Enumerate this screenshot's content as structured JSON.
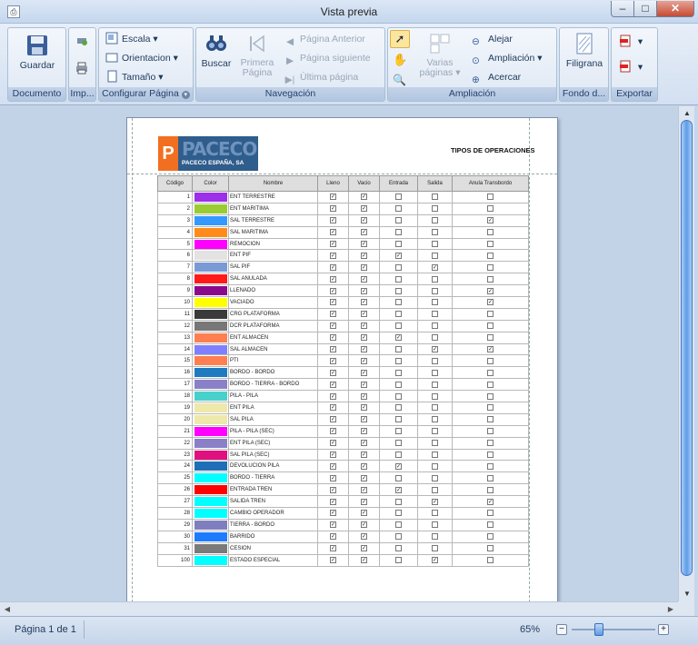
{
  "window": {
    "title": "Vista previa"
  },
  "ribbon": {
    "groups": {
      "documento": "Documento",
      "imprimir": "Imp...",
      "configurar": "Configurar Página",
      "navegacion": "Navegación",
      "ampliacion": "Ampliación",
      "fondo": "Fondo d...",
      "exportar": "Exportar"
    },
    "buttons": {
      "guardar": "Guardar",
      "escala": "Escala",
      "orientacion": "Orientacion",
      "tamano": "Tamaño",
      "buscar": "Buscar",
      "primera_pagina": "Primera Página",
      "pagina_anterior": "Página Anterior",
      "pagina_siguiente": "Página siguiente",
      "ultima_pagina": "Última página",
      "varias_paginas": "Varias páginas",
      "alejar": "Alejar",
      "ampliacion": "Ampliación",
      "acercar": "Acercar",
      "filigrana": "Filigrana"
    }
  },
  "document": {
    "logo_text": "PACECO",
    "logo_sub": "PACECO ESPAÑA, SA",
    "title": "TIPOS DE OPERACIONES",
    "dot": ".",
    "columns": [
      "Código",
      "Color",
      "Nombre",
      "Lleno",
      "Vacio",
      "Entrada",
      "Salida",
      "Anula Transbordo"
    ],
    "rows": [
      {
        "code": "1",
        "color": "#9b30e8",
        "name": "ENT TERRESTRE",
        "lleno": true,
        "vacio": true,
        "entrada": false,
        "salida": false,
        "anula": false
      },
      {
        "code": "2",
        "color": "#99cc33",
        "name": "ENT MARITIMA",
        "lleno": true,
        "vacio": true,
        "entrada": false,
        "salida": false,
        "anula": false
      },
      {
        "code": "3",
        "color": "#3399ff",
        "name": "SAL TERRESTRE",
        "lleno": true,
        "vacio": true,
        "entrada": false,
        "salida": false,
        "anula": true
      },
      {
        "code": "4",
        "color": "#ff8c1a",
        "name": "SAL MARITIMA",
        "lleno": true,
        "vacio": true,
        "entrada": false,
        "salida": false,
        "anula": false
      },
      {
        "code": "5",
        "color": "#ff00ff",
        "name": "REMOCION",
        "lleno": true,
        "vacio": true,
        "entrada": false,
        "salida": false,
        "anula": false
      },
      {
        "code": "6",
        "color": "#e3e3e3",
        "name": "ENT PIF",
        "lleno": true,
        "vacio": true,
        "entrada": true,
        "salida": false,
        "anula": false
      },
      {
        "code": "7",
        "color": "#7a9ad6",
        "name": "SAL PIF",
        "lleno": true,
        "vacio": true,
        "entrada": false,
        "salida": true,
        "anula": false
      },
      {
        "code": "8",
        "color": "#ff1a1a",
        "name": "SAL ANULADA",
        "lleno": true,
        "vacio": true,
        "entrada": false,
        "salida": false,
        "anula": false
      },
      {
        "code": "9",
        "color": "#8b0a8b",
        "name": "LLENADO",
        "lleno": true,
        "vacio": true,
        "entrada": false,
        "salida": false,
        "anula": true
      },
      {
        "code": "10",
        "color": "#ffff00",
        "name": "VACIADO",
        "lleno": true,
        "vacio": true,
        "entrada": false,
        "salida": false,
        "anula": true
      },
      {
        "code": "11",
        "color": "#3a3a3a",
        "name": "CRG PLATAFORMA",
        "lleno": true,
        "vacio": true,
        "entrada": false,
        "salida": false,
        "anula": false
      },
      {
        "code": "12",
        "color": "#777777",
        "name": "DCR PLATAFORMA",
        "lleno": true,
        "vacio": true,
        "entrada": false,
        "salida": false,
        "anula": false
      },
      {
        "code": "13",
        "color": "#ff7f50",
        "name": "ENT ALMACEN",
        "lleno": true,
        "vacio": true,
        "entrada": true,
        "salida": false,
        "anula": false
      },
      {
        "code": "14",
        "color": "#8080ff",
        "name": "SAL ALMACEN",
        "lleno": true,
        "vacio": true,
        "entrada": false,
        "salida": true,
        "anula": true
      },
      {
        "code": "15",
        "color": "#ff7f50",
        "name": "PTI",
        "lleno": true,
        "vacio": true,
        "entrada": false,
        "salida": false,
        "anula": false
      },
      {
        "code": "16",
        "color": "#1e7bbf",
        "name": "BORDO - BORDO",
        "lleno": true,
        "vacio": true,
        "entrada": false,
        "salida": false,
        "anula": false
      },
      {
        "code": "17",
        "color": "#8a80c8",
        "name": "BORDO - TIERRA - BORDO",
        "lleno": true,
        "vacio": true,
        "entrada": false,
        "salida": false,
        "anula": false
      },
      {
        "code": "18",
        "color": "#48d1cc",
        "name": "PILA - PILA",
        "lleno": true,
        "vacio": true,
        "entrada": false,
        "salida": false,
        "anula": false
      },
      {
        "code": "19",
        "color": "#eee8aa",
        "name": "ENT PILA",
        "lleno": true,
        "vacio": true,
        "entrada": false,
        "salida": false,
        "anula": false
      },
      {
        "code": "20",
        "color": "#eee8aa",
        "name": "SAL PILA",
        "lleno": true,
        "vacio": true,
        "entrada": false,
        "salida": false,
        "anula": false
      },
      {
        "code": "21",
        "color": "#ff00ff",
        "name": "PILA - PILA (SEC)",
        "lleno": true,
        "vacio": true,
        "entrada": false,
        "salida": false,
        "anula": false
      },
      {
        "code": "22",
        "color": "#8a80c8",
        "name": "ENT PILA (SEC)",
        "lleno": true,
        "vacio": true,
        "entrada": false,
        "salida": false,
        "anula": false
      },
      {
        "code": "23",
        "color": "#e0117e",
        "name": "SAL PILA (SEC)",
        "lleno": true,
        "vacio": true,
        "entrada": false,
        "salida": false,
        "anula": false
      },
      {
        "code": "24",
        "color": "#1e6fb8",
        "name": "DEVOLUCION PILA",
        "lleno": true,
        "vacio": true,
        "entrada": true,
        "salida": false,
        "anula": false
      },
      {
        "code": "25",
        "color": "#00ffff",
        "name": "BORDO - TIERRA",
        "lleno": true,
        "vacio": true,
        "entrada": false,
        "salida": false,
        "anula": false
      },
      {
        "code": "26",
        "color": "#ff0000",
        "name": "ENTRADA TREN",
        "lleno": true,
        "vacio": true,
        "entrada": true,
        "salida": false,
        "anula": false
      },
      {
        "code": "27",
        "color": "#00ffff",
        "name": "SALIDA TREN",
        "lleno": true,
        "vacio": true,
        "entrada": false,
        "salida": true,
        "anula": true
      },
      {
        "code": "28",
        "color": "#00ffff",
        "name": "CAMBIO OPERADOR",
        "lleno": true,
        "vacio": true,
        "entrada": false,
        "salida": false,
        "anula": false
      },
      {
        "code": "29",
        "color": "#7f7fc0",
        "name": "TIERRA - BORDO",
        "lleno": true,
        "vacio": true,
        "entrada": false,
        "salida": false,
        "anula": false
      },
      {
        "code": "30",
        "color": "#1e7bff",
        "name": "BARRIDO",
        "lleno": true,
        "vacio": true,
        "entrada": false,
        "salida": false,
        "anula": false
      },
      {
        "code": "31",
        "color": "#7a7a7a",
        "name": "CESION",
        "lleno": true,
        "vacio": true,
        "entrada": false,
        "salida": false,
        "anula": false
      },
      {
        "code": "100",
        "color": "#00ffff",
        "name": "ESTADO ESPECIAL",
        "lleno": true,
        "vacio": true,
        "entrada": false,
        "salida": true,
        "anula": false
      }
    ]
  },
  "status": {
    "page_label": "Página 1 de 1",
    "zoom_label": "65%",
    "zoom_level": 0.65
  },
  "icons": {
    "save": "save-icon",
    "print": "print-icon",
    "search": "binoculars-icon",
    "first": "first-page-icon",
    "prev": "prev-page-icon",
    "next": "next-page-icon",
    "last": "last-page-icon",
    "pointer": "pointer-icon",
    "hand": "hand-icon",
    "zoom_out": "zoom-out-icon",
    "zoom_in": "zoom-in-icon",
    "watermark": "watermark-icon",
    "pdf": "pdf-icon"
  }
}
